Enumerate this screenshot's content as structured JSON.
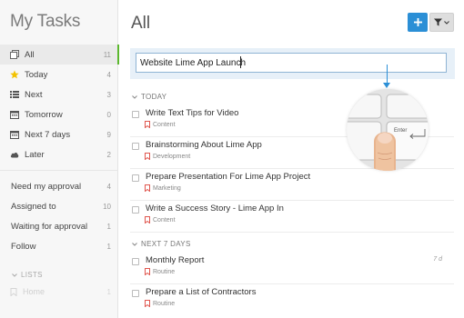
{
  "sidebar": {
    "title": "My Tasks",
    "items": [
      {
        "label": "All",
        "count": "11",
        "icon": "all-tasks-icon"
      },
      {
        "label": "Today",
        "count": "4",
        "icon": "star-icon"
      },
      {
        "label": "Next",
        "count": "3",
        "icon": "list-icon"
      },
      {
        "label": "Tomorrow",
        "count": "0",
        "icon": "calendar-icon"
      },
      {
        "label": "Next 7 days",
        "count": "9",
        "icon": "calendar-icon"
      },
      {
        "label": "Later",
        "count": "2",
        "icon": "cloud-icon"
      }
    ],
    "filters": [
      {
        "label": "Need my approval",
        "count": "4"
      },
      {
        "label": "Assigned to",
        "count": "10"
      },
      {
        "label": "Waiting for approval",
        "count": "1"
      },
      {
        "label": "Follow",
        "count": "1"
      }
    ],
    "lists_header": "LISTS",
    "lists": [
      {
        "label": "Home",
        "count": "1"
      }
    ]
  },
  "main": {
    "title": "All",
    "input_value": "Website Lime App Launch",
    "sections": [
      {
        "label": "TODAY",
        "tasks": [
          {
            "name": "Write Text Tips for Video",
            "tag": "Content"
          },
          {
            "name": "Brainstorming About Lime App",
            "tag": "Development"
          },
          {
            "name": "Prepare Presentation For Lime App Project",
            "tag": "Marketing"
          },
          {
            "name": "Write a Success Story - Lime App In",
            "tag": "Content"
          }
        ]
      },
      {
        "label": "NEXT 7 DAYS",
        "tasks": [
          {
            "name": "Monthly Report",
            "tag": "Routine",
            "due": "7 d"
          },
          {
            "name": "Prepare a List of Contractors",
            "tag": "Routine"
          }
        ]
      }
    ],
    "key_label": "Enter"
  },
  "colors": {
    "accent_blue": "#2b8fd6",
    "active_green": "#5cb82e",
    "tag_red": "#e0574f"
  }
}
